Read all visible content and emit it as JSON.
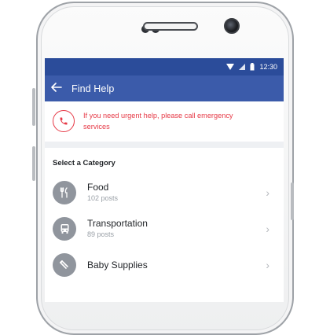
{
  "status_bar": {
    "time": "12:30",
    "wifi_icon": "wifi-icon",
    "signal_icon": "signal-icon",
    "battery_icon": "battery-icon"
  },
  "app_bar": {
    "back_icon": "arrow-left-icon",
    "title": "Find Help",
    "color": "#3b5baa"
  },
  "alert": {
    "icon": "phone-icon",
    "text": "If you need urgent help, please call emergency services",
    "color": "#e63946"
  },
  "section": {
    "title": "Select a Category"
  },
  "categories": [
    {
      "name": "Food",
      "count": "102 posts",
      "icon": "fork-knife-icon"
    },
    {
      "name": "Transportation",
      "count": "89 posts",
      "icon": "bus-icon"
    },
    {
      "name": "Baby Supplies",
      "count": "",
      "icon": "baby-bottle-icon"
    }
  ]
}
